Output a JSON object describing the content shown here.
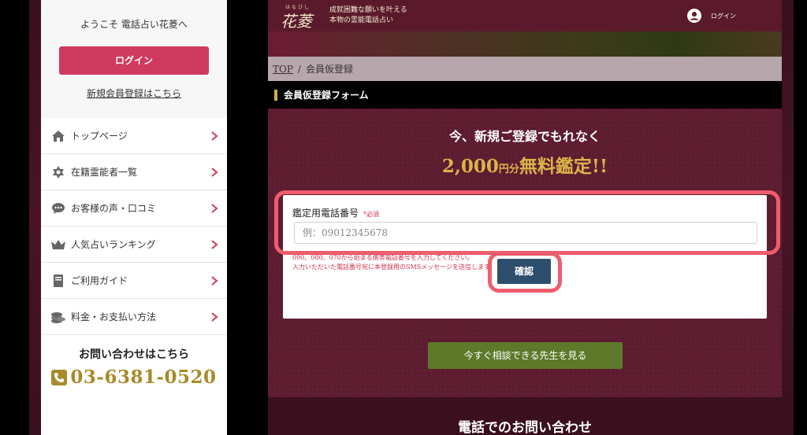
{
  "sidebar": {
    "welcome": "ようこそ 電話占い花菱へ",
    "login_button": "ログイン",
    "register_link": "新規会員登録はこちら",
    "nav": [
      {
        "label": "トップページ",
        "icon": "home-icon"
      },
      {
        "label": "在籍霊能者一覧",
        "icon": "star-of-david-icon"
      },
      {
        "label": "お客様の声・口コミ",
        "icon": "speech-bubble-icon"
      },
      {
        "label": "人気占いランキング",
        "icon": "crown-icon"
      },
      {
        "label": "ご利用ガイド",
        "icon": "book-icon"
      },
      {
        "label": "料金・お支払い方法",
        "icon": "coins-icon"
      }
    ],
    "contact_title": "お問い合わせはこちら",
    "phone": "03-6381-0520"
  },
  "header": {
    "logo_ruby": "はなびし",
    "logo": "花菱",
    "tagline_line1": "成就困難な願いを叶える",
    "tagline_line2": "本物の霊能電話占い",
    "login_label": "ログイン"
  },
  "breadcrumb": {
    "top": "TOP",
    "separator": "/",
    "current": "会員仮登録"
  },
  "section_title": "会員仮登録フォーム",
  "promo": {
    "line1": "今、新規ご登録でもれなく",
    "amount": "2,000",
    "unit": "円分",
    "suffix": "無料鑑定!!"
  },
  "form": {
    "label": "鑑定用電話番号",
    "required": "*必須",
    "placeholder": "例：09012345678",
    "hint_line1": "090、080、070から始まる携帯電話番号を入力してください。",
    "hint_line2": "入力いただいた電話番号宛に本登録用のSMSメッセージを送信します。",
    "confirm_button": "確認"
  },
  "consult_button": "今すぐ相談できる先生を見る",
  "footer_title": "電話でのお問い合わせ",
  "colors": {
    "accent_pink": "#d03a5e",
    "brand_maroon": "#5e1c30",
    "gold": "#a88a2a",
    "confirm_blue": "#2e4e6e",
    "consult_green": "#5c7a2a",
    "highlight": "#ef5d6d"
  }
}
